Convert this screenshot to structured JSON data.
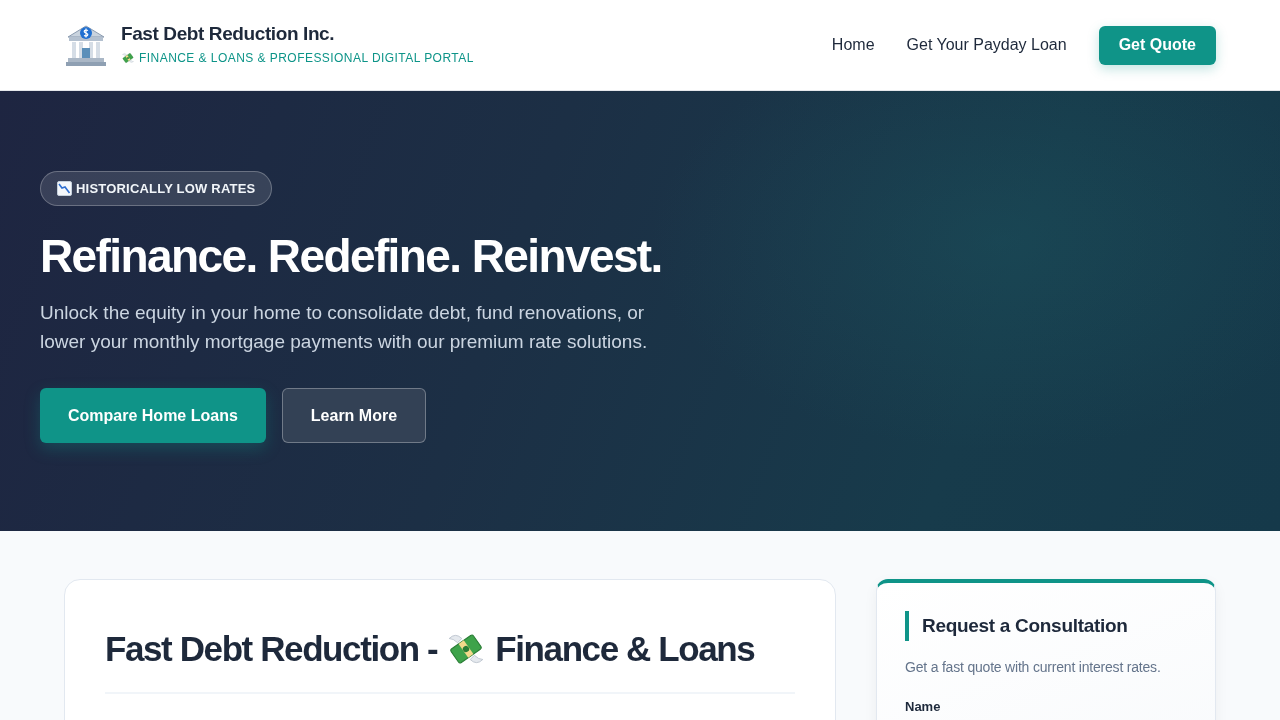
{
  "header": {
    "brand": {
      "name": "Fast Debt Reduction Inc.",
      "tagline": "FINANCE & LOANS & PROFESSIONAL DIGITAL PORTAL"
    },
    "nav": [
      {
        "label": "Home"
      },
      {
        "label": "Get Your Payday Loan"
      }
    ],
    "cta": "Get Quote"
  },
  "hero": {
    "badge": "HISTORICALLY LOW RATES",
    "title": "Refinance. Redefine. Reinvest.",
    "text": "Unlock the equity in your home to consolidate debt, fund renovations, or lower your monthly mortgage payments with our premium rate solutions.",
    "buttons": [
      {
        "label": "Compare Home Loans",
        "kind": "primary"
      },
      {
        "label": "Learn More",
        "kind": "secondary"
      }
    ]
  },
  "article": {
    "title_before": "Fast Debt Reduction -",
    "title_after": "Finance & Loans"
  },
  "sidebar": {
    "title": "Request a Consultation",
    "subtitle": "Get a fast quote with current interest rates.",
    "fields": [
      {
        "label": "Name"
      }
    ]
  }
}
